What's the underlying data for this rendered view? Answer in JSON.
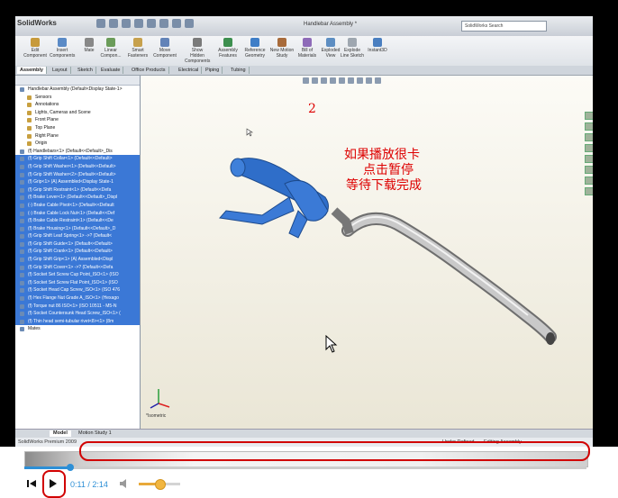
{
  "app": {
    "brand": "SolidWorks",
    "doc_title": "Handlebar Assembly *",
    "search_placeholder": "SolidWorks Search"
  },
  "ribbon": [
    {
      "label": "Edit Component",
      "icon": "edit-component-icon"
    },
    {
      "label": "Insert Components",
      "icon": "insert-components-icon"
    },
    {
      "label": "Mate",
      "icon": "mate-icon"
    },
    {
      "label": "Linear Compon...",
      "icon": "linear-pattern-icon"
    },
    {
      "label": "Smart Fasteners",
      "icon": "smart-fasteners-icon"
    },
    {
      "label": "Move Component",
      "icon": "move-component-icon"
    },
    {
      "label": "Show Hidden Components",
      "icon": "show-hidden-icon"
    },
    {
      "label": "Assembly Features",
      "icon": "assembly-features-icon"
    },
    {
      "label": "Reference Geometry",
      "icon": "reference-geometry-icon"
    },
    {
      "label": "New Motion Study",
      "icon": "motion-study-icon"
    },
    {
      "label": "Bill of Materials",
      "icon": "bom-icon"
    },
    {
      "label": "Exploded View",
      "icon": "exploded-view-icon"
    },
    {
      "label": "Explode Line Sketch",
      "icon": "explode-line-icon"
    },
    {
      "label": "Instant3D",
      "icon": "instant3d-icon"
    }
  ],
  "tabs": [
    "Assembly",
    "Layout",
    "Sketch",
    "Evaluate",
    "Office Products",
    "Electrical",
    "Piping",
    "Tubing"
  ],
  "tree": {
    "root": "Handlebar Assembly  (Default<Display State-1>",
    "items": [
      {
        "label": "Sensors",
        "sel": false,
        "sub": true
      },
      {
        "label": "Annotations",
        "sel": false,
        "sub": true
      },
      {
        "label": "Lights, Cameras and Scene",
        "sel": false,
        "sub": true
      },
      {
        "label": "Front Plane",
        "sel": false,
        "sub": true
      },
      {
        "label": "Top Plane",
        "sel": false,
        "sub": true
      },
      {
        "label": "Right Plane",
        "sel": false,
        "sub": true
      },
      {
        "label": "Origin",
        "sel": false,
        "sub": true
      },
      {
        "label": "(f) Handlebars<1> (Default<<Default>_Dis",
        "sel": false,
        "sub": false
      },
      {
        "label": "(f) Grip Shift Collar<1> (Default<<Default>",
        "sel": true,
        "sub": false
      },
      {
        "label": "(f) Grip Shift Washer<1> (Default<<Default>",
        "sel": true,
        "sub": false
      },
      {
        "label": "(f) Grip Shift Washer<2> (Default<<Default>",
        "sel": true,
        "sub": false
      },
      {
        "label": "(f) Grip<1> (A) Assembled<Display State-1",
        "sel": true,
        "sub": false
      },
      {
        "label": "(f) Grip Shift Restraint<1> (Default<<Defa",
        "sel": true,
        "sub": false
      },
      {
        "label": "(f) Brake Lever<1> (Default<<Default>_Displ",
        "sel": true,
        "sub": false
      },
      {
        "label": "(-) Brake Cable Pivot<1> (Default<<Default",
        "sel": true,
        "sub": false
      },
      {
        "label": "(-) Brake Cable Lock Nut<1> (Default<<Def",
        "sel": true,
        "sub": false
      },
      {
        "label": "(f) Brake Cable Restraint<1> (Default<<De",
        "sel": true,
        "sub": false
      },
      {
        "label": "(f) Brake Housing<1> (Default<<Default>_D",
        "sel": true,
        "sub": false
      },
      {
        "label": "(f) Grip Shift Leaf Spring<1> ->? (Default<",
        "sel": true,
        "sub": false
      },
      {
        "label": "(f) Grip Shift Guide<1> (Default<<Default>",
        "sel": true,
        "sub": false
      },
      {
        "label": "(f) Grip Shift Crank<1> (Default<<Default>",
        "sel": true,
        "sub": false
      },
      {
        "label": "(f) Grip Shift Grip<1> (A) Assembled<Displ",
        "sel": true,
        "sub": false
      },
      {
        "label": "(f) Grip Shift Cover<1> ->? (Default<<Defa",
        "sel": true,
        "sub": false
      },
      {
        "label": "(f) Socket Set Screw Cup Point_ISO<1> (ISO",
        "sel": true,
        "sub": false
      },
      {
        "label": "(f) Socket Set Screw Flat Point_ISO<1> (ISO",
        "sel": true,
        "sub": false
      },
      {
        "label": "(f) Socket Head Cap Screw_ISO<1> (ISO 476",
        "sel": true,
        "sub": false
      },
      {
        "label": "(f) Hex Flange Nut Grade A_ISO<1> (Hexago",
        "sel": true,
        "sub": false
      },
      {
        "label": "(f) Torque nut 86 ISO<1> (ISO 10511 - M5-N",
        "sel": true,
        "sub": false
      },
      {
        "label": "(f) Socket Countersunk Head Screw_ISO<1> (",
        "sel": true,
        "sub": false
      },
      {
        "label": "(f) Thin head semi-tubular rivet<8><1> (8m",
        "sel": true,
        "sub": false
      },
      {
        "label": "Mates",
        "sel": false,
        "sub": false
      }
    ]
  },
  "viewport": {
    "overlay_number": "2",
    "overlay_lines": [
      "如果播放很卡",
      "点击暂停",
      "等待下载完成"
    ],
    "view_label": "*Isometric"
  },
  "bottom_tabs": [
    "Model",
    "Motion Study 1"
  ],
  "status": {
    "left": "SolidWorks Premium 2009",
    "middle": "Under Defined",
    "right": "Editing Assembly"
  },
  "player": {
    "time": "0:11 / 2:14",
    "progress": 0.082,
    "volume": 0.5,
    "accent": "#2d8fd6",
    "volume_color": "#f2b640"
  }
}
